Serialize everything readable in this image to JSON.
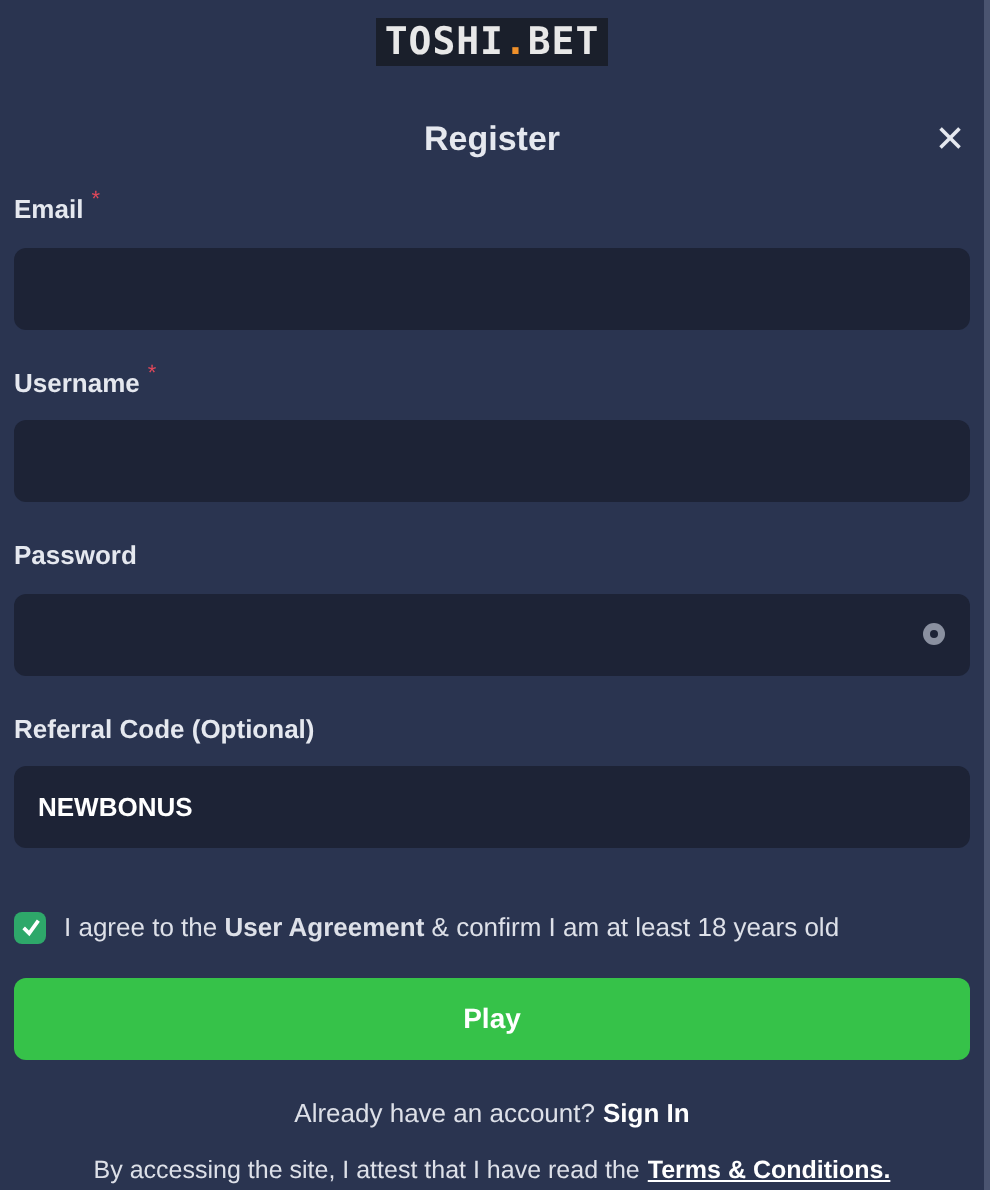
{
  "logo": {
    "parts": [
      {
        "text": "TOSHI",
        "accent": false
      },
      {
        "text": ".",
        "accent": true
      },
      {
        "text": "BET",
        "accent": false
      }
    ]
  },
  "dialog": {
    "title": "Register",
    "close": "×"
  },
  "fields": [
    {
      "kind": "text",
      "label": "Email",
      "required_mark": "*"
    },
    {
      "kind": "text",
      "label": "Username",
      "required_mark": "*"
    },
    {
      "kind": "password",
      "label": "Password"
    },
    {
      "kind": "text",
      "label": "Referral Code (Optional)",
      "value": "NEWBONUS"
    }
  ],
  "agreement": {
    "checked": true,
    "text": "I agree to the **User Agreement** & confirm I am at least 18 years old"
  },
  "play_button": "Play",
  "signin": {
    "text": "Already have an account?",
    "link": "Sign In"
  },
  "terms": {
    "text": "By accessing the site, I attest that I have read the",
    "link": "Terms & Conditions."
  }
}
